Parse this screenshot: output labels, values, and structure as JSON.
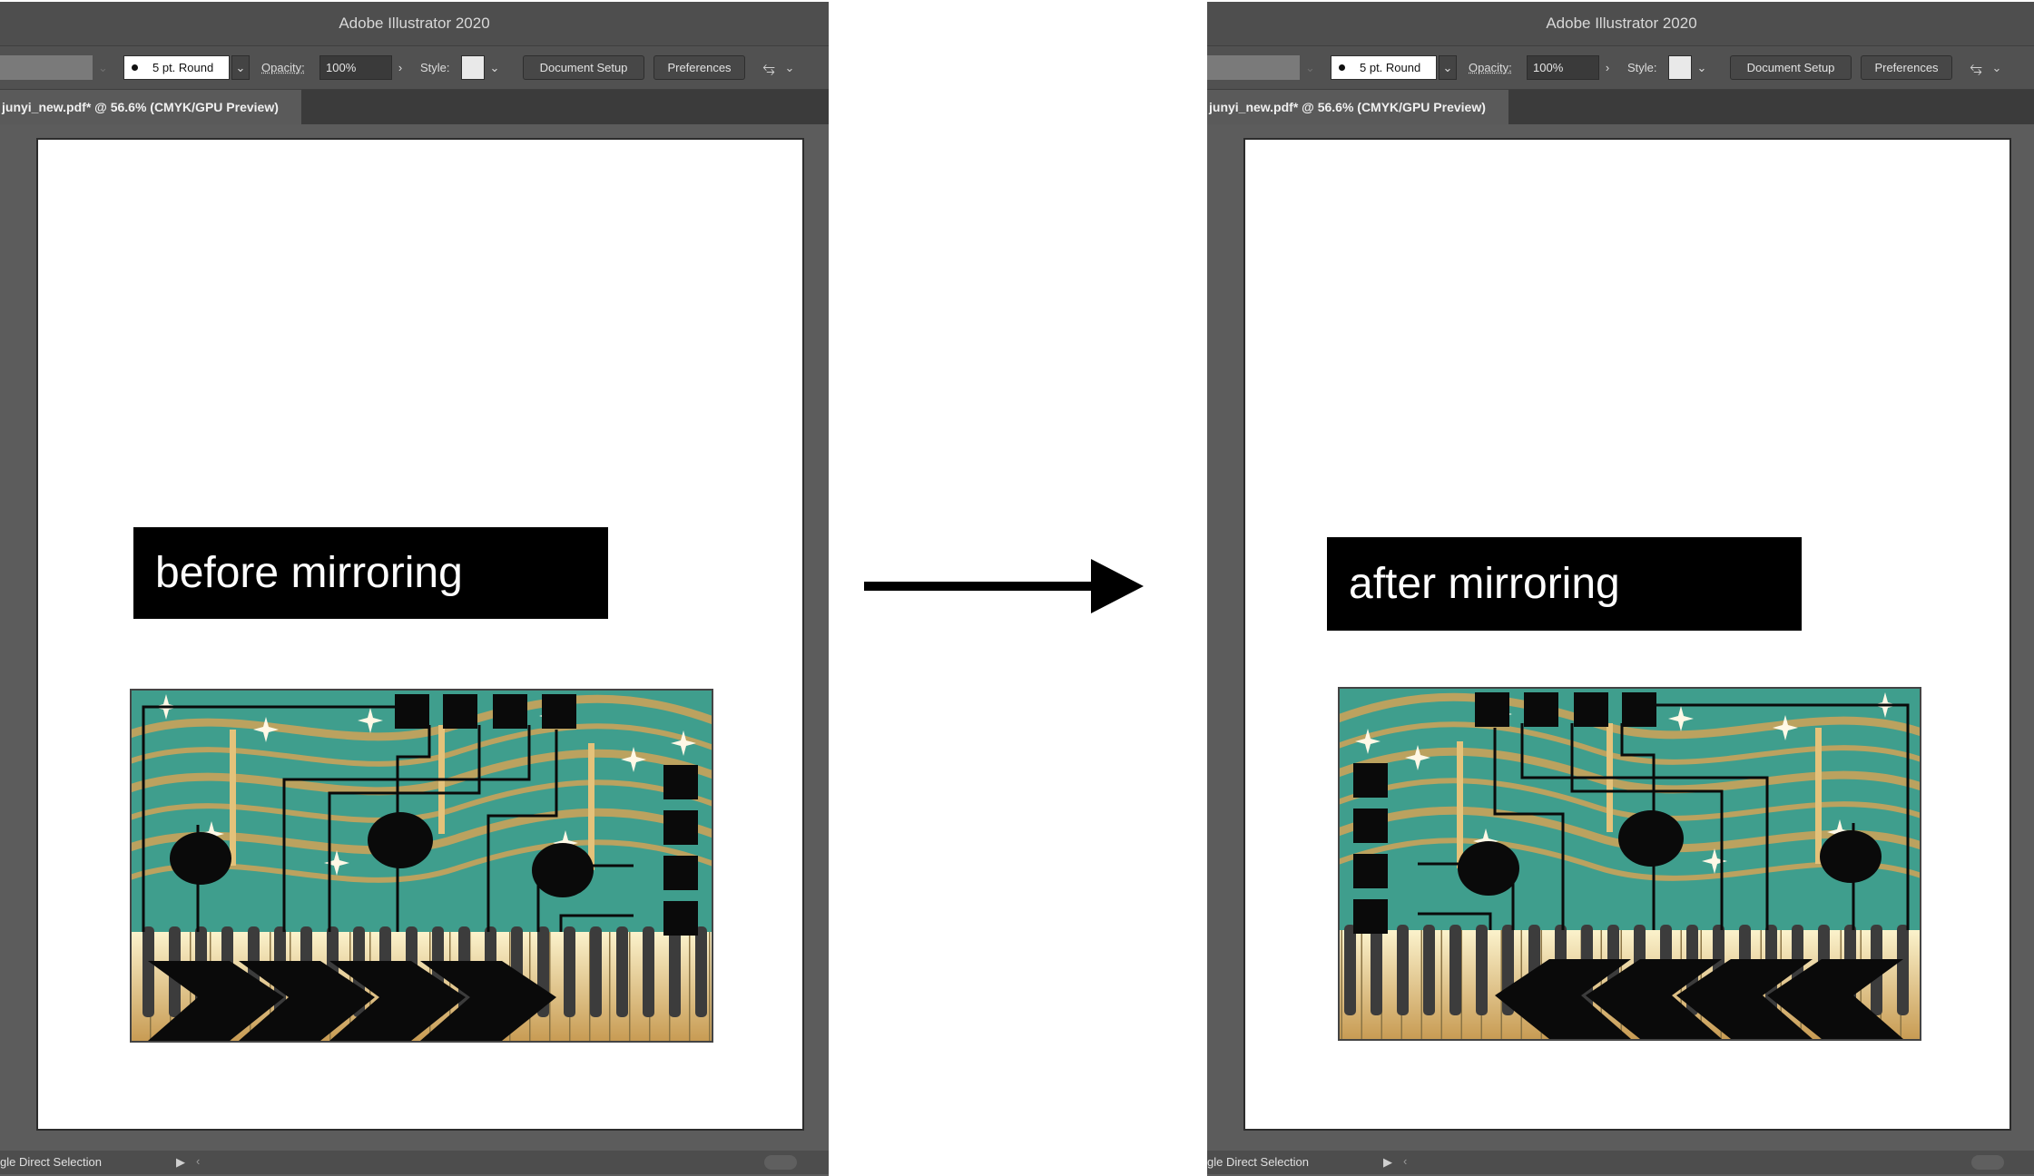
{
  "app_title": "Adobe Illustrator 2020",
  "controls": {
    "stroke_profile": "5 pt. Round",
    "opacity_label": "Opacity:",
    "opacity_value": "100%",
    "style_label": "Style:",
    "document_setup": "Document Setup",
    "preferences": "Preferences"
  },
  "document_tab": "junyi_new.pdf* @ 56.6% (CMYK/GPU Preview)",
  "status_tool": "gle Direct Selection",
  "panels": {
    "before": {
      "caption": "before mirroring"
    },
    "after": {
      "caption": "after mirroring"
    }
  },
  "colors": {
    "board_teal": "#3f9e8d",
    "gold": "#c9a25a",
    "pad_black": "#0a0a0a",
    "ui_dark": "#5c5c5c"
  },
  "icons": [
    "dropdown-chevron-icon",
    "pin-icon",
    "play-icon",
    "arrow-right-icon"
  ]
}
